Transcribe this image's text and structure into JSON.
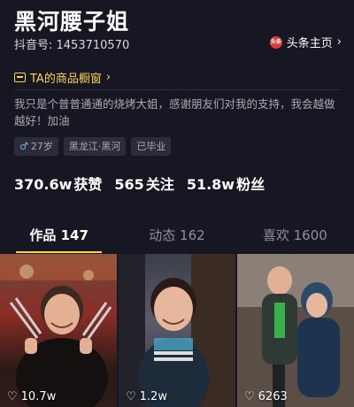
{
  "profile": {
    "name": "黑河腰子姐",
    "douyin_id": "抖音号: 1453710570",
    "toutiao_badge": "头条",
    "toutiao_link": "头条主页",
    "toutiao_chevron": "›",
    "shop_window": "TA的商品橱窗",
    "shop_chevron": "›",
    "bio": "我只是个普普通通的烧烤大姐，感谢朋友们对我的支持，我会越做越好！加油",
    "tags": {
      "age_gender_icon": "♂",
      "age": "27岁",
      "location": "黑龙江·黑河",
      "education": "已毕业"
    },
    "stats": {
      "likes_value": "370.6w",
      "likes_label": "获赞",
      "following_value": "565",
      "following_label": "关注",
      "followers_value": "51.8w",
      "followers_label": "粉丝"
    }
  },
  "tabs": [
    {
      "label": "作品 147",
      "active": true
    },
    {
      "label": "动态 162",
      "active": false
    },
    {
      "label": "喜欢 1600",
      "active": false
    }
  ],
  "videos": [
    {
      "likes": "10.7w",
      "icon": "heart-outline-icon"
    },
    {
      "likes": "1.2w",
      "icon": "heart-outline-icon"
    },
    {
      "likes": "6263",
      "icon": "heart-outline-icon"
    }
  ],
  "colors": {
    "background": "#161722",
    "accent": "#fbd34b",
    "toutiao_red": "#e23a3a"
  }
}
